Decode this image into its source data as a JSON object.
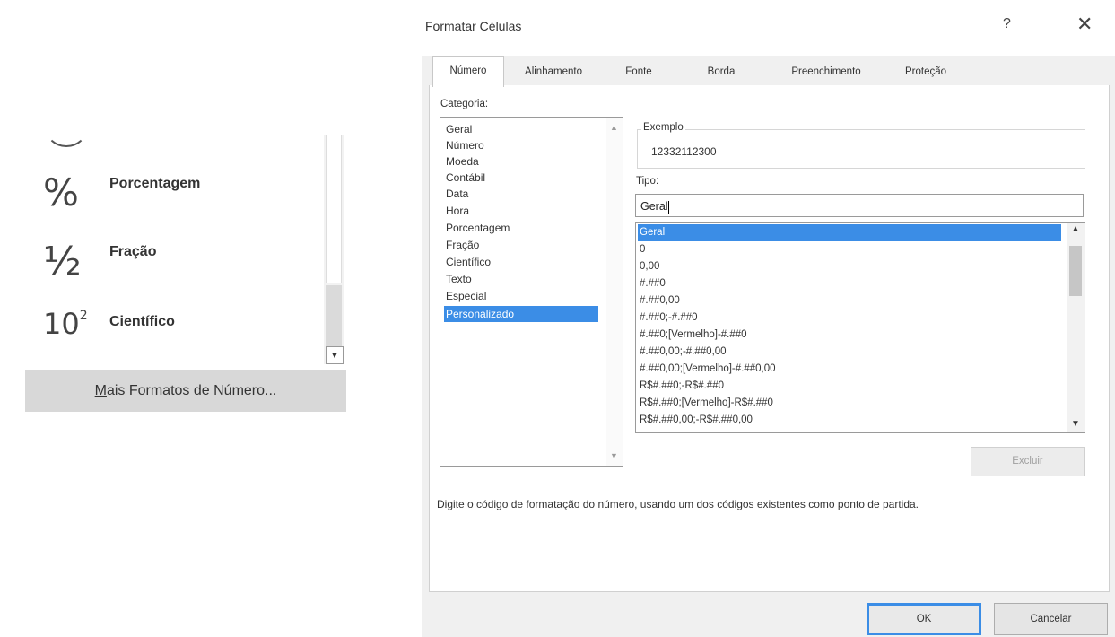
{
  "left_panel": {
    "items": [
      {
        "symbol": "%",
        "label": "Porcentagem"
      },
      {
        "symbol": "½",
        "label": "Fração"
      },
      {
        "symbol": "10",
        "exponent": "2",
        "label": "Científico"
      }
    ],
    "more_formats_prefix": "M",
    "more_formats_rest": "ais Formatos de Número..."
  },
  "dialog": {
    "title": "Formatar Células",
    "help": "?",
    "close": "✕",
    "tabs": [
      "Número",
      "Alinhamento",
      "Fonte",
      "Borda",
      "Preenchimento",
      "Proteção"
    ],
    "active_tab": "Número",
    "category_label": "Categoria:",
    "categories": [
      "Geral",
      "Número",
      "Moeda",
      "Contábil",
      "Data",
      "Hora",
      "Porcentagem",
      "Fração",
      "Científico",
      "Texto",
      "Especial",
      "Personalizado"
    ],
    "selected_category": "Personalizado",
    "example_label": "Exemplo",
    "example_value": "12332112300",
    "type_label": "Tipo:",
    "type_value": "Geral",
    "type_options": [
      "Geral",
      "0",
      "0,00",
      "#.##0",
      "#.##0,00",
      "#.##0;-#.##0",
      "#.##0;[Vermelho]-#.##0",
      "#.##0,00;-#.##0,00",
      "#.##0,00;[Vermelho]-#.##0,00",
      "R$#.##0;-R$#.##0",
      "R$#.##0;[Vermelho]-R$#.##0",
      "R$#.##0,00;-R$#.##0,00"
    ],
    "selected_type": "Geral",
    "delete_label": "Excluir",
    "hint": "Digite o código de formatação do número, usando um dos códigos existentes como ponto de partida.",
    "ok_label": "OK",
    "cancel_label": "Cancelar"
  },
  "colors": {
    "selection": "#3b8de6",
    "dialog_bg": "#f0f0f0",
    "menu_highlight": "#d8d8d8"
  }
}
